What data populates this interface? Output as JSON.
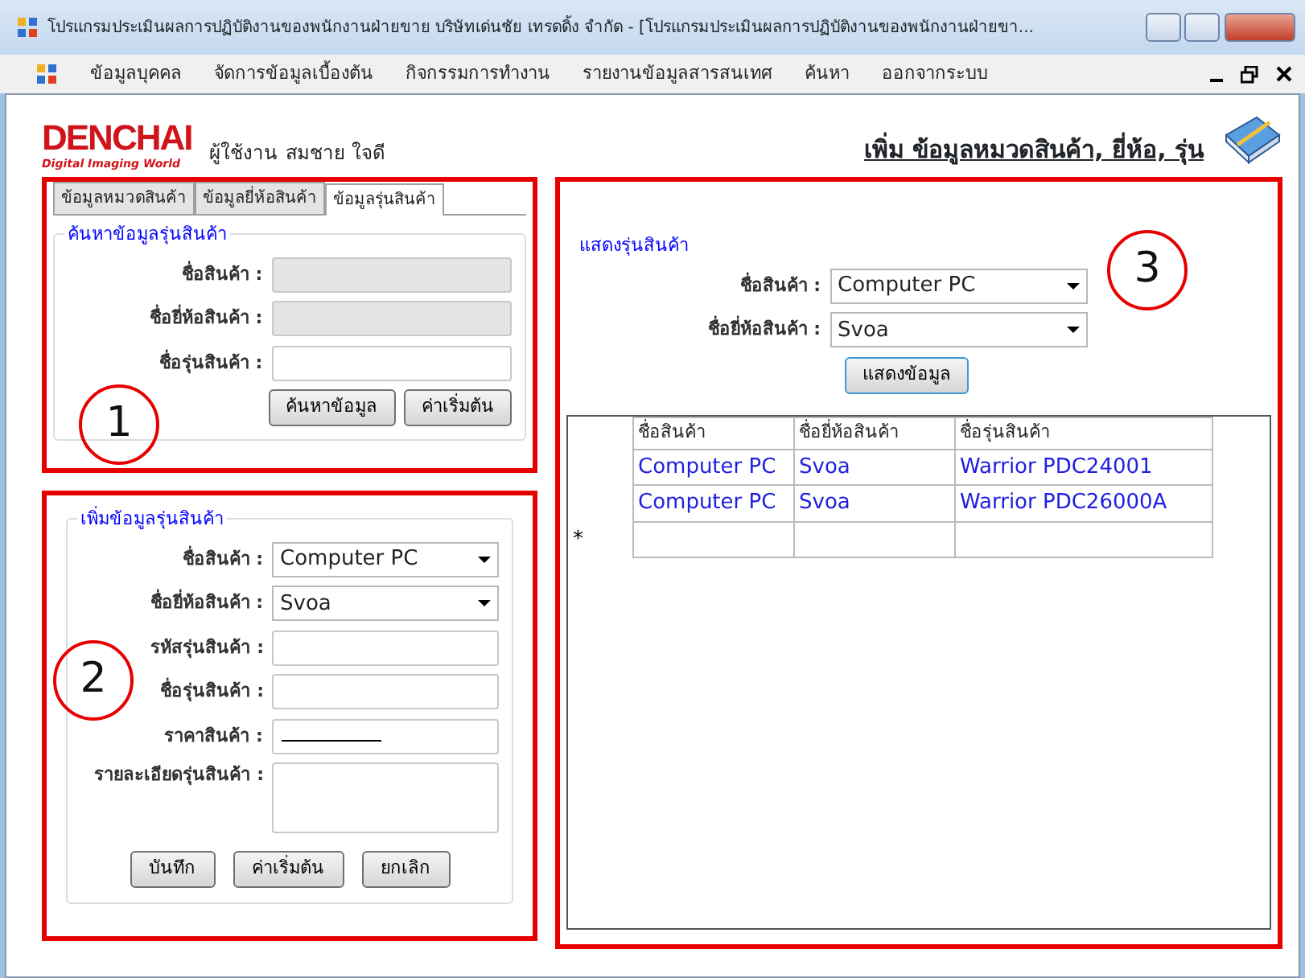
{
  "window": {
    "title": "โปรแกรมประเมินผลการปฏิบัติงานของพนักงานฝ่ายขาย บริษัทเด่นชัย เทรดดิ้ง จำกัด - [โปรแกรมประเมินผลการปฏิบัติงานของพนักงานฝ่ายขา..."
  },
  "menu": {
    "items": [
      "ข้อมูลบุคคล",
      "จัดการข้อมูลเบื้องต้น",
      "กิจกรรมการทำงาน",
      "รายงานข้อมูลสารสนเทศ",
      "ค้นหา",
      "ออกจากระบบ"
    ]
  },
  "header": {
    "logo": "DENCHAI",
    "tagline": "Digital Imaging World",
    "user_label": "ผู้ใช้งาน",
    "user_name": "สมชาย ใจดี",
    "page_title": "เพิ่ม ข้อมูลหมวดสินค้า, ยี่ห้อ, รุ่น"
  },
  "tabs": [
    {
      "label": "ข้อมูลหมวดสินค้า",
      "selected": false
    },
    {
      "label": "ข้อมูลยี่ห้อสินค้า",
      "selected": false
    },
    {
      "label": "ข้อมูลรุ่นสินค้า",
      "selected": true
    }
  ],
  "search_group": {
    "legend": "ค้นหาข้อมูลรุ่นสินค้า",
    "annotation": "1",
    "fields": [
      {
        "label": "ชื่อสินค้า :",
        "kind": "text",
        "disabled": true
      },
      {
        "label": "ชื่อยี่ห้อสินค้า :",
        "kind": "text",
        "disabled": true
      },
      {
        "label": "ชื่อรุ่นสินค้า :",
        "kind": "text",
        "disabled": false
      }
    ],
    "buttons": [
      "ค้นหาข้อมูล",
      "ค่าเริ่มต้น"
    ]
  },
  "add_group": {
    "legend": "เพิ่มข้อมูลรุ่นสินค้า",
    "annotation": "2",
    "fields": [
      {
        "label": "ชื่อสินค้า :",
        "kind": "combo",
        "value": "Computer PC"
      },
      {
        "label": "ชื่อยี่ห้อสินค้า :",
        "kind": "combo",
        "value": "Svoa"
      },
      {
        "label": "รหัสรุ่นสินค้า :",
        "kind": "text"
      },
      {
        "label": "ชื่อรุ่นสินค้า :",
        "kind": "text"
      },
      {
        "label": "ราคาสินค้า :",
        "kind": "masked"
      },
      {
        "label": "รายละเอียดรุ่นสินค้า :",
        "kind": "textarea"
      }
    ],
    "buttons": [
      "บันทึก",
      "ค่าเริ่มต้น",
      "ยกเลิก"
    ]
  },
  "show_group": {
    "legend": "แสดงรุ่นสินค้า",
    "annotation": "3",
    "fields": [
      {
        "label": "ชื่อสินค้า :",
        "kind": "combo",
        "value": "Computer PC"
      },
      {
        "label": "ชื่อยี่ห้อสินค้า :",
        "kind": "combo",
        "value": "Svoa"
      }
    ],
    "button": "แสดงข้อมูล",
    "table": {
      "columns": [
        "ชื่อสินค้า",
        "ชื่อยี่ห้อสินค้า",
        "ชื่อรุ่นสินค้า"
      ],
      "rows": [
        [
          "Computer PC",
          "Svoa",
          "Warrior PDC24001"
        ],
        [
          "Computer PC",
          "Svoa",
          "Warrior PDC26000A"
        ]
      ],
      "new_row_marker": "*"
    }
  }
}
